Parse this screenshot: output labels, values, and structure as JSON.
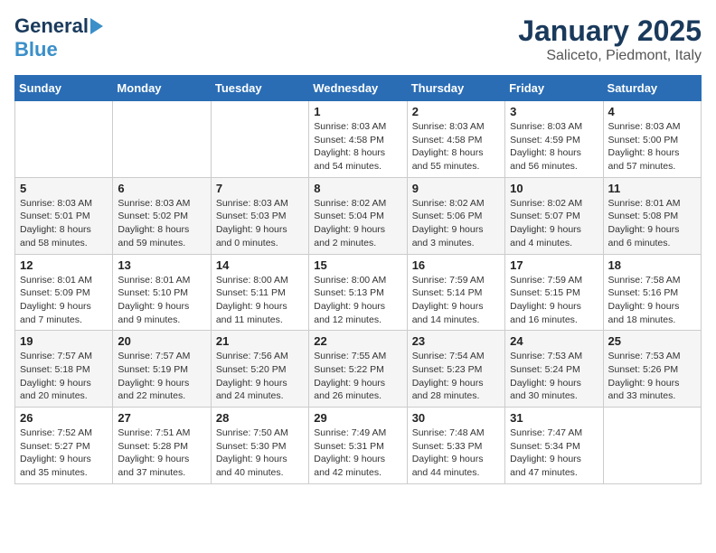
{
  "header": {
    "logo_line1": "General",
    "logo_line2": "Blue",
    "title": "January 2025",
    "subtitle": "Saliceto, Piedmont, Italy"
  },
  "calendar": {
    "days_of_week": [
      "Sunday",
      "Monday",
      "Tuesday",
      "Wednesday",
      "Thursday",
      "Friday",
      "Saturday"
    ],
    "weeks": [
      [
        {
          "day": "",
          "info": ""
        },
        {
          "day": "",
          "info": ""
        },
        {
          "day": "",
          "info": ""
        },
        {
          "day": "1",
          "info": "Sunrise: 8:03 AM\nSunset: 4:58 PM\nDaylight: 8 hours\nand 54 minutes."
        },
        {
          "day": "2",
          "info": "Sunrise: 8:03 AM\nSunset: 4:58 PM\nDaylight: 8 hours\nand 55 minutes."
        },
        {
          "day": "3",
          "info": "Sunrise: 8:03 AM\nSunset: 4:59 PM\nDaylight: 8 hours\nand 56 minutes."
        },
        {
          "day": "4",
          "info": "Sunrise: 8:03 AM\nSunset: 5:00 PM\nDaylight: 8 hours\nand 57 minutes."
        }
      ],
      [
        {
          "day": "5",
          "info": "Sunrise: 8:03 AM\nSunset: 5:01 PM\nDaylight: 8 hours\nand 58 minutes."
        },
        {
          "day": "6",
          "info": "Sunrise: 8:03 AM\nSunset: 5:02 PM\nDaylight: 8 hours\nand 59 minutes."
        },
        {
          "day": "7",
          "info": "Sunrise: 8:03 AM\nSunset: 5:03 PM\nDaylight: 9 hours\nand 0 minutes."
        },
        {
          "day": "8",
          "info": "Sunrise: 8:02 AM\nSunset: 5:04 PM\nDaylight: 9 hours\nand 2 minutes."
        },
        {
          "day": "9",
          "info": "Sunrise: 8:02 AM\nSunset: 5:06 PM\nDaylight: 9 hours\nand 3 minutes."
        },
        {
          "day": "10",
          "info": "Sunrise: 8:02 AM\nSunset: 5:07 PM\nDaylight: 9 hours\nand 4 minutes."
        },
        {
          "day": "11",
          "info": "Sunrise: 8:01 AM\nSunset: 5:08 PM\nDaylight: 9 hours\nand 6 minutes."
        }
      ],
      [
        {
          "day": "12",
          "info": "Sunrise: 8:01 AM\nSunset: 5:09 PM\nDaylight: 9 hours\nand 7 minutes."
        },
        {
          "day": "13",
          "info": "Sunrise: 8:01 AM\nSunset: 5:10 PM\nDaylight: 9 hours\nand 9 minutes."
        },
        {
          "day": "14",
          "info": "Sunrise: 8:00 AM\nSunset: 5:11 PM\nDaylight: 9 hours\nand 11 minutes."
        },
        {
          "day": "15",
          "info": "Sunrise: 8:00 AM\nSunset: 5:13 PM\nDaylight: 9 hours\nand 12 minutes."
        },
        {
          "day": "16",
          "info": "Sunrise: 7:59 AM\nSunset: 5:14 PM\nDaylight: 9 hours\nand 14 minutes."
        },
        {
          "day": "17",
          "info": "Sunrise: 7:59 AM\nSunset: 5:15 PM\nDaylight: 9 hours\nand 16 minutes."
        },
        {
          "day": "18",
          "info": "Sunrise: 7:58 AM\nSunset: 5:16 PM\nDaylight: 9 hours\nand 18 minutes."
        }
      ],
      [
        {
          "day": "19",
          "info": "Sunrise: 7:57 AM\nSunset: 5:18 PM\nDaylight: 9 hours\nand 20 minutes."
        },
        {
          "day": "20",
          "info": "Sunrise: 7:57 AM\nSunset: 5:19 PM\nDaylight: 9 hours\nand 22 minutes."
        },
        {
          "day": "21",
          "info": "Sunrise: 7:56 AM\nSunset: 5:20 PM\nDaylight: 9 hours\nand 24 minutes."
        },
        {
          "day": "22",
          "info": "Sunrise: 7:55 AM\nSunset: 5:22 PM\nDaylight: 9 hours\nand 26 minutes."
        },
        {
          "day": "23",
          "info": "Sunrise: 7:54 AM\nSunset: 5:23 PM\nDaylight: 9 hours\nand 28 minutes."
        },
        {
          "day": "24",
          "info": "Sunrise: 7:53 AM\nSunset: 5:24 PM\nDaylight: 9 hours\nand 30 minutes."
        },
        {
          "day": "25",
          "info": "Sunrise: 7:53 AM\nSunset: 5:26 PM\nDaylight: 9 hours\nand 33 minutes."
        }
      ],
      [
        {
          "day": "26",
          "info": "Sunrise: 7:52 AM\nSunset: 5:27 PM\nDaylight: 9 hours\nand 35 minutes."
        },
        {
          "day": "27",
          "info": "Sunrise: 7:51 AM\nSunset: 5:28 PM\nDaylight: 9 hours\nand 37 minutes."
        },
        {
          "day": "28",
          "info": "Sunrise: 7:50 AM\nSunset: 5:30 PM\nDaylight: 9 hours\nand 40 minutes."
        },
        {
          "day": "29",
          "info": "Sunrise: 7:49 AM\nSunset: 5:31 PM\nDaylight: 9 hours\nand 42 minutes."
        },
        {
          "day": "30",
          "info": "Sunrise: 7:48 AM\nSunset: 5:33 PM\nDaylight: 9 hours\nand 44 minutes."
        },
        {
          "day": "31",
          "info": "Sunrise: 7:47 AM\nSunset: 5:34 PM\nDaylight: 9 hours\nand 47 minutes."
        },
        {
          "day": "",
          "info": ""
        }
      ]
    ]
  }
}
